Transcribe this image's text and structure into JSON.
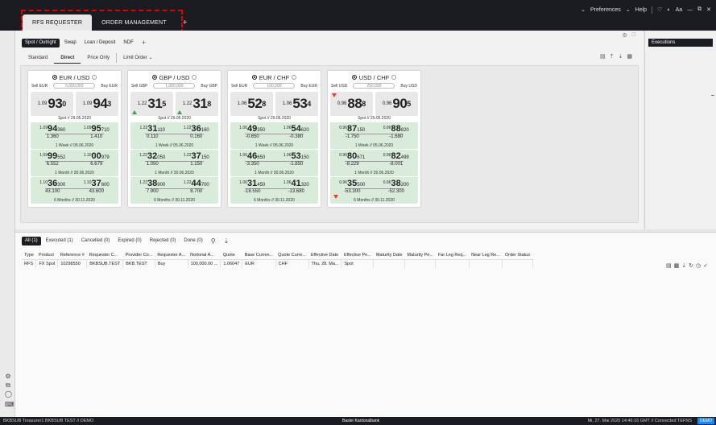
{
  "header": {
    "tabs": [
      "RFS REQUESTER",
      "ORDER MANAGEMENT"
    ],
    "add_tab": "+",
    "right": {
      "preferences": "Preferences",
      "help": "Help",
      "font_size": "Aa"
    }
  },
  "product_tabs": [
    "Spot / Outright",
    "Swap",
    "Loan / Deposit",
    "NDF"
  ],
  "product_add": "+",
  "mode_tabs": [
    "Standard",
    "Direct",
    "Price Only",
    "Limit Order"
  ],
  "executions": {
    "title": "Executions"
  },
  "cards": [
    {
      "pair": "EUR / USD",
      "sell": "Sell EUR",
      "buy": "Buy EUR",
      "amount": "5,000,000",
      "spot": {
        "bid": {
          "pre": "1.09",
          "big": "93",
          "pip": "0"
        },
        "ask": {
          "pre": "1.09",
          "big": "94",
          "pip": "3"
        },
        "label": "Spot // 29.05.2020"
      },
      "rows": [
        {
          "bid": {
            "pre": "1.09",
            "big": "94",
            "sm": "360"
          },
          "ask": {
            "pre": "1.09",
            "big": "95",
            "sm": "710"
          },
          "bp": "1.360",
          "ap": "1.410",
          "tenor": "1 Week // 05.06.2020"
        },
        {
          "bid": {
            "pre": "1.09",
            "big": "99",
            "sm": "552"
          },
          "ask": {
            "pre": "1.10",
            "big": "00",
            "sm": "979"
          },
          "bp": "6.552",
          "ap": "6.679",
          "tenor": "1 Month // 30.06.2020"
        },
        {
          "bid": {
            "pre": "1.10",
            "big": "36",
            "sm": "300"
          },
          "ask": {
            "pre": "1.10",
            "big": "37",
            "sm": "600"
          },
          "bp": "43.100",
          "ap": "43.600",
          "tenor": "6 Months // 30.11.2020"
        }
      ]
    },
    {
      "pair": "GBP / USD",
      "sell": "Sell GBP",
      "buy": "Buy GBP",
      "amount": "1,000,000",
      "spot": {
        "bid": {
          "pre": "1.22",
          "big": "31",
          "pip": "5"
        },
        "ask": {
          "pre": "1.22",
          "big": "31",
          "pip": "8"
        },
        "label": "Spot // 29.05.2020"
      },
      "rows": [
        {
          "bid": {
            "pre": "1.22",
            "big": "31",
            "sm": "110"
          },
          "ask": {
            "pre": "1.22",
            "big": "36",
            "sm": "160"
          },
          "bp": "0.110",
          "ap": "0.160",
          "tenor": "1 Week // 05.06.2020"
        },
        {
          "bid": {
            "pre": "1.22",
            "big": "32",
            "sm": "050"
          },
          "ask": {
            "pre": "1.22",
            "big": "37",
            "sm": "150"
          },
          "bp": "1.050",
          "ap": "1.150",
          "tenor": "1 Month // 30.06.2020"
        },
        {
          "bid": {
            "pre": "1.22",
            "big": "38",
            "sm": "900"
          },
          "ask": {
            "pre": "1.22",
            "big": "44",
            "sm": "700"
          },
          "bp": "7.900",
          "ap": "8.700",
          "tenor": "6 Months // 30.11.2020"
        }
      ]
    },
    {
      "pair": "EUR / CHF",
      "sell": "Sell EUR",
      "buy": "Buy EUR",
      "amount": "100,000",
      "spot": {
        "bid": {
          "pre": "1.06",
          "big": "52",
          "pip": "8"
        },
        "ask": {
          "pre": "1.06",
          "big": "53",
          "pip": "4"
        },
        "label": "Spot // 29.05.2020"
      },
      "rows": [
        {
          "bid": {
            "pre": "1.06",
            "big": "49",
            "sm": "350"
          },
          "ask": {
            "pre": "1.06",
            "big": "54",
            "sm": "620"
          },
          "bp": "-0.650",
          "ap": "-0.380",
          "tenor": "1 Week // 05.06.2020"
        },
        {
          "bid": {
            "pre": "1.06",
            "big": "46",
            "sm": "650"
          },
          "ask": {
            "pre": "1.06",
            "big": "53",
            "sm": "150"
          },
          "bp": "-3.350",
          "ap": "-1.850",
          "tenor": "1 Month // 30.06.2020"
        },
        {
          "bid": {
            "pre": "1.06",
            "big": "31",
            "sm": "450"
          },
          "ask": {
            "pre": "1.06",
            "big": "41",
            "sm": "320"
          },
          "bp": "-18.550",
          "ap": "-13.680",
          "tenor": "6 Months // 30.11.2020"
        }
      ]
    },
    {
      "pair": "USD / CHF",
      "sell": "Sell USD",
      "buy": "Buy USD",
      "amount": "250,000",
      "spot": {
        "bid": {
          "pre": "0.96",
          "big": "88",
          "pip": "8"
        },
        "ask": {
          "pre": "0.96",
          "big": "90",
          "pip": "5"
        },
        "label": "Spot // 29.05.2020"
      },
      "rows": [
        {
          "bid": {
            "pre": "0.96",
            "big": "87",
            "sm": "150"
          },
          "ask": {
            "pre": "0.96",
            "big": "88",
            "sm": "820"
          },
          "bp": "-1.750",
          "ap": "-1.680",
          "tenor": "1 Week // 05.06.2020"
        },
        {
          "bid": {
            "pre": "0.96",
            "big": "80",
            "sm": "671"
          },
          "ask": {
            "pre": "0.96",
            "big": "82",
            "sm": "499"
          },
          "bp": "-8.229",
          "ap": "-8.001",
          "tenor": "1 Month // 30.06.2020"
        },
        {
          "bid": {
            "pre": "0.96",
            "big": "35",
            "sm": "500"
          },
          "ask": {
            "pre": "0.96",
            "big": "38",
            "sm": "200"
          },
          "bp": "-53.300",
          "ap": "-52.300",
          "tenor": "6 Months // 30.11.2020"
        }
      ]
    }
  ],
  "order_tabs": [
    "All (1)",
    "Executed (1)",
    "Cancelled (0)",
    "Expired (0)",
    "Rejected (0)",
    "Done (0)"
  ],
  "table": {
    "headers": [
      "Type",
      "Product",
      "Reference #",
      "Requester C...",
      "Provider Co...",
      "Requester A...",
      "Notional A...",
      "Quote",
      "Base Curren...",
      "Quote Curre...",
      "Effective Date",
      "Effective Pe...",
      "Maturity Date",
      "Maturity Pe...",
      "Far Leg Req...",
      "Near Leg Re...",
      "Order Status"
    ],
    "rows": [
      [
        "RFS",
        "FX Spot",
        "10298550",
        "BKBSUB.TEST",
        "BKB.TEST",
        "Buy",
        "100,000.00 ...",
        "1.06047",
        "EUR",
        "CHF",
        "Thu, 28. Ma...",
        "Spot",
        "",
        "",
        "",
        "",
        ""
      ]
    ]
  },
  "status": {
    "left": "BKBSUB Treasurer1  BKBSUB TEST  //  DEMO",
    "center": "Basler Kantonalbank",
    "right": "Mi, 27. Mai 2020 14:46:16 GMT  //  Connected  TEFNS",
    "demo": "DEMO"
  }
}
